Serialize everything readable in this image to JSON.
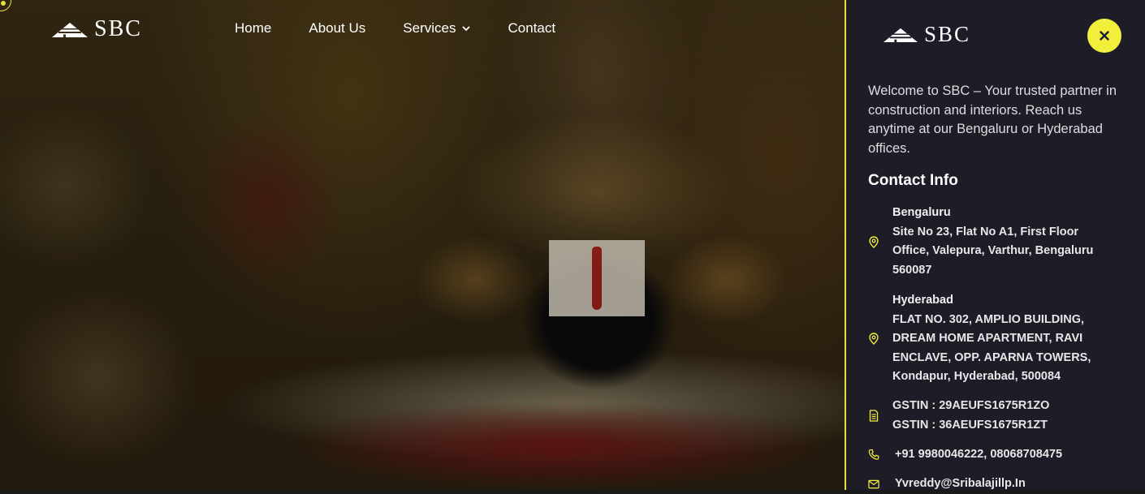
{
  "brand": {
    "logo_text": "SBC"
  },
  "nav": {
    "items": [
      {
        "label": "Home"
      },
      {
        "label": "About Us"
      },
      {
        "label": "Services"
      },
      {
        "label": "Contact"
      }
    ]
  },
  "panel": {
    "close_icon": "close-icon",
    "welcome": "Welcome to SBC – Your trusted partner in construction and interiors. Reach us anytime at our Bengaluru or Hyderabad offices.",
    "contact_title": "Contact Info",
    "bengaluru": {
      "city": "Bengaluru",
      "lines": [
        "Site No 23, Flat No A1, First Floor",
        "Office, Valepura, Varthur, Bengaluru",
        "560087"
      ]
    },
    "hyderabad": {
      "city": "Hyderabad",
      "lines": [
        "FLAT NO. 302, AMPLIO BUILDING,",
        "DREAM HOME APARTMENT, RAVI",
        "ENCLAVE, OPP. APARNA TOWERS,",
        "Kondapur, Hyderabad, 500084"
      ]
    },
    "gstin": [
      "GSTIN : 29AEUFS1675R1ZO",
      "GSTIN : 36AEUFS1675R1ZT"
    ],
    "phone": "+91 9980046222, 08068708475",
    "email": "Yvreddy@Sribalajillp.In"
  },
  "colors": {
    "accent": "#f2ee3c",
    "panel_bg": "#1d1c27"
  }
}
